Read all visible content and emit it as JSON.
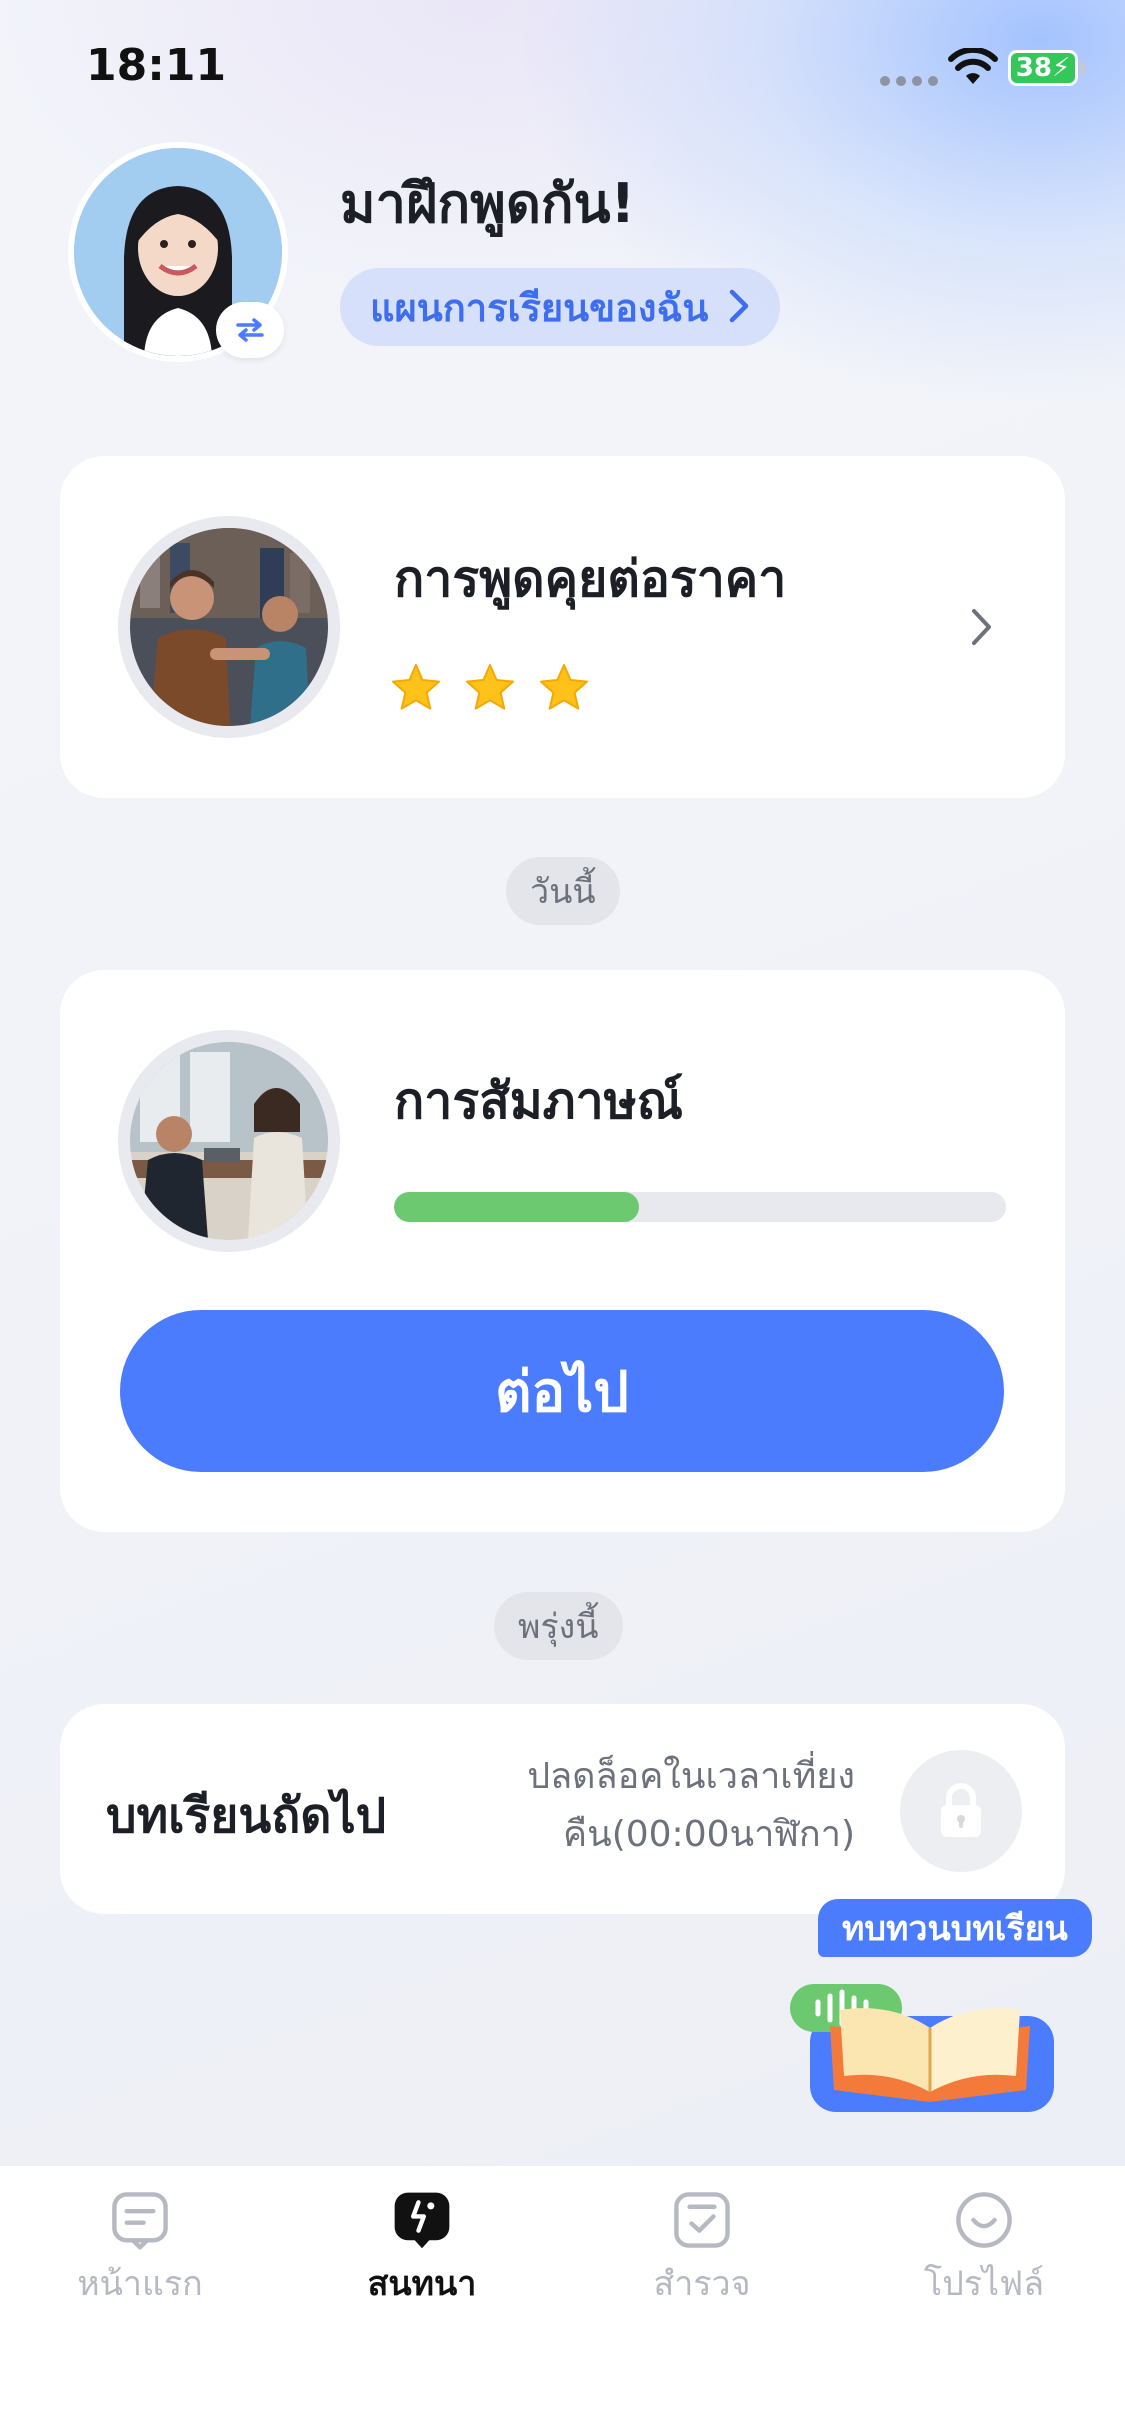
{
  "status_bar": {
    "time": "18:11",
    "battery": "38"
  },
  "header": {
    "greeting": "มาฝึกพูดกัน!",
    "plan_label": "แผนการเรียนของฉัน"
  },
  "completed_lesson": {
    "title": "การพูดคุยต่อราคา",
    "stars": 3,
    "image_icon": "negotiation-photo"
  },
  "today": {
    "label": "วันนี้",
    "lesson_title": "การสัมภาษณ์",
    "progress": 0.4,
    "button_label": "ต่อไป",
    "image_icon": "interview-photo"
  },
  "tomorrow": {
    "label": "พรุ่งนี้",
    "next_title": "บทเรียนถัดไป",
    "unlock_line1": "ปลดล็อคในเวลาเที่ยง",
    "unlock_line2": "คืน(00:00นาฬิกา)",
    "icon": "lock-icon"
  },
  "review": {
    "label": "ทบทวนบทเรียน",
    "icon": "open-book-icon"
  },
  "tabs": [
    {
      "label": "หน้าแรก",
      "icon": "home-chat-icon",
      "active": false
    },
    {
      "label": "สนทนา",
      "icon": "talk-icon",
      "active": true
    },
    {
      "label": "สำรวจ",
      "icon": "explore-check-icon",
      "active": false
    },
    {
      "label": "โปรไฟล์",
      "icon": "smile-profile-icon",
      "active": false
    }
  ],
  "colors": {
    "accent": "#4c7cfe",
    "progress": "#6cc96f",
    "star": "#ffc21a",
    "battery": "#34c759"
  }
}
